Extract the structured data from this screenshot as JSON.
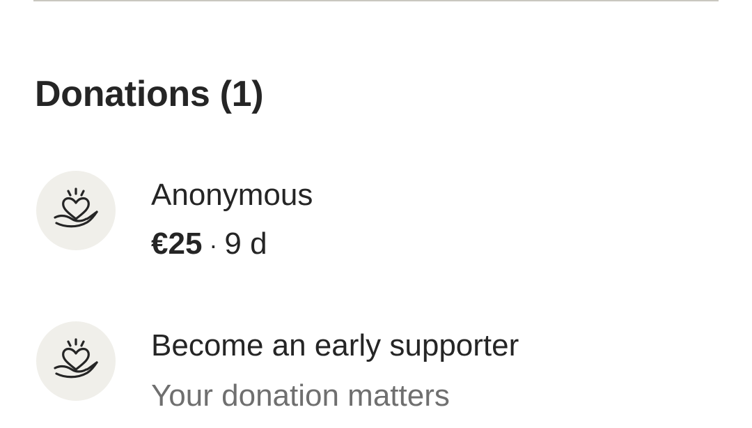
{
  "donations": {
    "title": "Donations (1)",
    "items": [
      {
        "icon": "heart-in-hand-icon",
        "name": "Anonymous",
        "amount": "€25",
        "separator": "·",
        "age": "9 d"
      }
    ],
    "cta": {
      "icon": "heart-in-hand-icon",
      "title": "Become an early supporter",
      "subtitle": "Your donation matters"
    }
  },
  "colors": {
    "text": "#252525",
    "muted_text": "#6f6f6f",
    "avatar_bg": "#f0efea",
    "divider": "#c9c7bf"
  }
}
